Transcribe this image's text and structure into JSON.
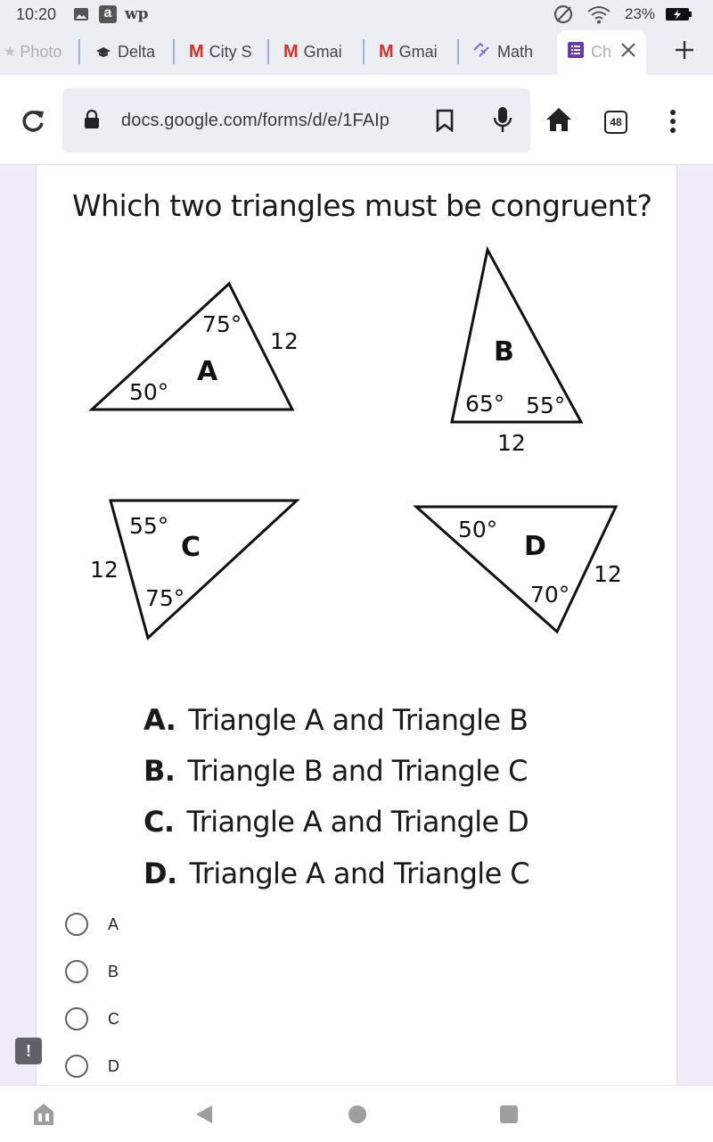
{
  "status_bar": {
    "time": "10:20",
    "battery_percent": "23%",
    "icons": [
      "image-icon",
      "amazon-icon",
      "washington-post-icon",
      "do-not-disturb-icon",
      "wifi-icon",
      "battery-charging-icon"
    ],
    "wp_text": "wp",
    "amazon_text": "a"
  },
  "tabs": [
    {
      "label": "Photo",
      "icon": "star-icon"
    },
    {
      "label": "Delta",
      "icon": "graduation-cap-icon"
    },
    {
      "label": "City S",
      "icon": "gmail-icon"
    },
    {
      "label": "Gmai",
      "icon": "gmail-icon"
    },
    {
      "label": "Gmai",
      "icon": "gmail-icon"
    },
    {
      "label": "Math",
      "icon": "math-link-icon"
    },
    {
      "label": "Ch",
      "icon": "forms-icon",
      "active": true
    }
  ],
  "gmail_glyph": "M",
  "url_bar": {
    "url": "docs.google.com/forms/d/e/1FAIp",
    "tab_count": "48"
  },
  "question": {
    "text": "Which two triangles must be congruent?",
    "figure": {
      "triangle_A": {
        "name": "A",
        "angle_top": "75°",
        "angle_left": "50°",
        "side": "12"
      },
      "triangle_B": {
        "name": "B",
        "angle_left": "65°",
        "angle_right": "55°",
        "side": "12"
      },
      "triangle_C": {
        "name": "C",
        "angle_top": "55°",
        "angle_bottom": "75°",
        "side": "12"
      },
      "triangle_D": {
        "name": "D",
        "angle_left": "50°",
        "angle_bottom": "70°",
        "side": "12"
      }
    },
    "choices": [
      {
        "letter": "A.",
        "text": "Triangle A and Triangle B"
      },
      {
        "letter": "B.",
        "text": "Triangle B and Triangle C"
      },
      {
        "letter": "C.",
        "text": "Triangle A and Triangle D"
      },
      {
        "letter": "D.",
        "text": "Triangle A and Triangle C"
      }
    ]
  },
  "options": [
    {
      "label": "A"
    },
    {
      "label": "B"
    },
    {
      "label": "C"
    },
    {
      "label": "D"
    }
  ],
  "feedback_glyph": "!",
  "colors": {
    "chrome_bg": "#eceef4",
    "forms_purple": "#673ab7",
    "page_bg": "#f0ebf8",
    "gmail_red": "#d93025"
  }
}
